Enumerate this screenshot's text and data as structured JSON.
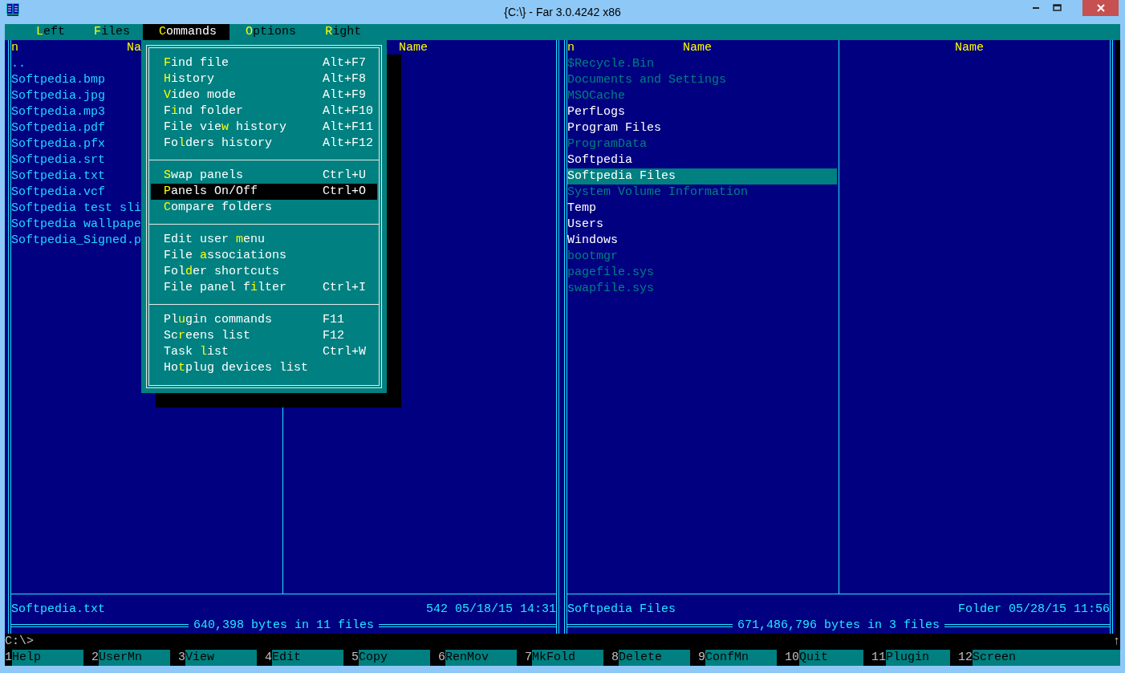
{
  "window": {
    "title": "{C:\\} - Far 3.0.4242 x86"
  },
  "menu_bar": [
    {
      "label": "**L**eft",
      "selected": false
    },
    {
      "label": "**F**iles",
      "selected": false
    },
    {
      "label": "**C**ommands",
      "selected": true
    },
    {
      "label": "**O**ptions",
      "selected": false
    },
    {
      "label": "**R**ight",
      "selected": false
    }
  ],
  "dropdown": {
    "groups": [
      [
        {
          "label": "**F**ind file",
          "shortcut": "Alt+F7",
          "selected": false
        },
        {
          "label": "**H**istory",
          "shortcut": "Alt+F8",
          "selected": false
        },
        {
          "label": "**V**ideo mode",
          "shortcut": "Alt+F9",
          "selected": false
        },
        {
          "label": "F**i**nd folder",
          "shortcut": "Alt+F10",
          "selected": false
        },
        {
          "label": "File vie**w** history",
          "shortcut": "Alt+F11",
          "selected": false
        },
        {
          "label": "Fo**l**ders history",
          "shortcut": "Alt+F12",
          "selected": false
        }
      ],
      [
        {
          "label": "**S**wap panels",
          "shortcut": "Ctrl+U",
          "selected": false
        },
        {
          "label": "**P**anels On/Off",
          "shortcut": "Ctrl+O",
          "selected": true
        },
        {
          "label": "**C**ompare folders",
          "selected": false
        }
      ],
      [
        {
          "label": "Edit user **m**enu",
          "selected": false
        },
        {
          "label": "File **a**ssociations",
          "selected": false
        },
        {
          "label": "Fol**d**er shortcuts",
          "selected": false
        },
        {
          "label": "File panel f**i**lter",
          "shortcut": "Ctrl+I",
          "selected": false
        }
      ],
      [
        {
          "label": "Pl**u**gin commands",
          "shortcut": "F11",
          "selected": false
        },
        {
          "label": "Sc**r**eens list",
          "shortcut": "F12",
          "selected": false
        },
        {
          "label": "Task **l**ist",
          "shortcut": "Ctrl+W",
          "selected": false
        },
        {
          "label": "Ho**t**plug devices list",
          "selected": false
        }
      ]
    ]
  },
  "left_panel": {
    "sort_indicator": "n",
    "columns": [
      "Na",
      "Name"
    ],
    "files": [
      {
        "name": "..",
        "kind": "file",
        "selected": false
      },
      {
        "name": "Softpedia.bmp",
        "kind": "file",
        "selected": false
      },
      {
        "name": "Softpedia.jpg",
        "kind": "file",
        "selected": false
      },
      {
        "name": "Softpedia.mp3",
        "kind": "file",
        "selected": false
      },
      {
        "name": "Softpedia.pdf",
        "kind": "file",
        "selected": false
      },
      {
        "name": "Softpedia.pfx",
        "kind": "file",
        "selected": false
      },
      {
        "name": "Softpedia.srt",
        "kind": "file",
        "selected": false
      },
      {
        "name": "Softpedia.txt",
        "kind": "file",
        "selected": false
      },
      {
        "name": "Softpedia.vcf",
        "kind": "file",
        "selected": false
      },
      {
        "name": "Softpedia test sli",
        "kind": "file",
        "selected": false
      },
      {
        "name": "Softpedia wallpape",
        "kind": "file",
        "selected": false
      },
      {
        "name": "Softpedia_Signed.p",
        "kind": "file",
        "selected": false
      }
    ],
    "info": {
      "name": "Softpedia.txt",
      "details": "542 05/18/15 14:31"
    },
    "totals": "640,398 bytes in 11 files"
  },
  "right_panel": {
    "sort_indicator": "n",
    "columns": [
      "Name",
      "Name"
    ],
    "files": [
      {
        "name": "$Recycle.Bin",
        "kind": "system",
        "selected": false
      },
      {
        "name": "Documents and Settings",
        "kind": "system",
        "selected": false
      },
      {
        "name": "MSOCache",
        "kind": "system",
        "selected": false
      },
      {
        "name": "PerfLogs",
        "kind": "folder",
        "selected": false
      },
      {
        "name": "Program Files",
        "kind": "folder",
        "selected": false
      },
      {
        "name": "ProgramData",
        "kind": "system",
        "selected": false
      },
      {
        "name": "Softpedia",
        "kind": "folder",
        "selected": false
      },
      {
        "name": "Softpedia Files",
        "kind": "folder",
        "selected": true
      },
      {
        "name": "System Volume Information",
        "kind": "system",
        "selected": false
      },
      {
        "name": "Temp",
        "kind": "folder",
        "selected": false
      },
      {
        "name": "Users",
        "kind": "folder",
        "selected": false
      },
      {
        "name": "Windows",
        "kind": "folder",
        "selected": false
      },
      {
        "name": "bootmgr",
        "kind": "system",
        "selected": false
      },
      {
        "name": "pagefile.sys",
        "kind": "system",
        "selected": false
      },
      {
        "name": "swapfile.sys",
        "kind": "system",
        "selected": false
      }
    ],
    "info": {
      "name": "Softpedia Files",
      "details": "Folder 05/28/15 11:56"
    },
    "totals": "671,486,796 bytes in 3 files"
  },
  "command_line": {
    "prompt": "C:\\>",
    "scroll_marker": "↑"
  },
  "key_bar": [
    {
      "key": "1",
      "label": "Help"
    },
    {
      "key": "2",
      "label": "UserMn"
    },
    {
      "key": "3",
      "label": "View"
    },
    {
      "key": "4",
      "label": "Edit"
    },
    {
      "key": "5",
      "label": "Copy"
    },
    {
      "key": "6",
      "label": "RenMov"
    },
    {
      "key": "7",
      "label": "MkFold"
    },
    {
      "key": "8",
      "label": "Delete"
    },
    {
      "key": "9",
      "label": "ConfMn"
    },
    {
      "key": "10",
      "label": "Quit"
    },
    {
      "key": "11",
      "label": "Plugin"
    },
    {
      "key": "12",
      "label": "Screen"
    }
  ]
}
